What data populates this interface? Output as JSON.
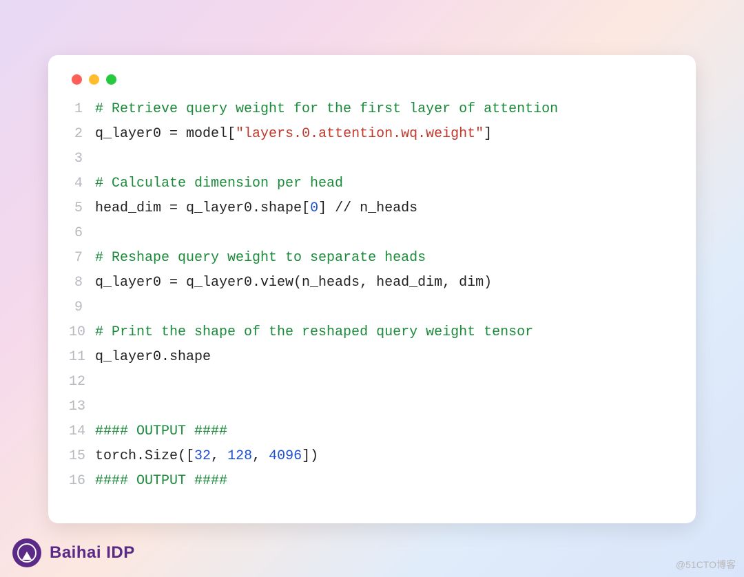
{
  "brand": "Baihai IDP",
  "watermark": "@51CTO博客",
  "code": {
    "lines": [
      {
        "n": "1",
        "seg": [
          {
            "cls": "c-comment",
            "t": "# Retrieve query weight for the first layer of attention"
          }
        ]
      },
      {
        "n": "2",
        "seg": [
          {
            "cls": "",
            "t": "q_layer0 = model["
          },
          {
            "cls": "c-str",
            "t": "\"layers.0.attention.wq.weight\""
          },
          {
            "cls": "",
            "t": "]"
          }
        ]
      },
      {
        "n": "3",
        "seg": [
          {
            "cls": "",
            "t": ""
          }
        ]
      },
      {
        "n": "4",
        "seg": [
          {
            "cls": "c-comment",
            "t": "# Calculate dimension per head"
          }
        ]
      },
      {
        "n": "5",
        "seg": [
          {
            "cls": "",
            "t": "head_dim = q_layer0.shape["
          },
          {
            "cls": "c-num",
            "t": "0"
          },
          {
            "cls": "",
            "t": "] // n_heads"
          }
        ]
      },
      {
        "n": "6",
        "seg": [
          {
            "cls": "",
            "t": ""
          }
        ]
      },
      {
        "n": "7",
        "seg": [
          {
            "cls": "c-comment",
            "t": "# Reshape query weight to separate heads"
          }
        ]
      },
      {
        "n": "8",
        "seg": [
          {
            "cls": "",
            "t": "q_layer0 = q_layer0.view(n_heads, head_dim, dim)"
          }
        ]
      },
      {
        "n": "9",
        "seg": [
          {
            "cls": "",
            "t": ""
          }
        ]
      },
      {
        "n": "10",
        "seg": [
          {
            "cls": "c-comment",
            "t": "# Print the shape of the reshaped query weight tensor"
          }
        ]
      },
      {
        "n": "11",
        "seg": [
          {
            "cls": "",
            "t": "q_layer0.shape"
          }
        ]
      },
      {
        "n": "12",
        "seg": [
          {
            "cls": "",
            "t": ""
          }
        ]
      },
      {
        "n": "13",
        "seg": [
          {
            "cls": "",
            "t": ""
          }
        ]
      },
      {
        "n": "14",
        "seg": [
          {
            "cls": "c-comment",
            "t": "#### OUTPUT ####"
          }
        ]
      },
      {
        "n": "15",
        "seg": [
          {
            "cls": "",
            "t": "torch.Size(["
          },
          {
            "cls": "c-num",
            "t": "32"
          },
          {
            "cls": "",
            "t": ", "
          },
          {
            "cls": "c-num",
            "t": "128"
          },
          {
            "cls": "",
            "t": ", "
          },
          {
            "cls": "c-num",
            "t": "4096"
          },
          {
            "cls": "",
            "t": "])"
          }
        ]
      },
      {
        "n": "16",
        "seg": [
          {
            "cls": "c-comment",
            "t": "#### OUTPUT ####"
          }
        ]
      }
    ]
  }
}
